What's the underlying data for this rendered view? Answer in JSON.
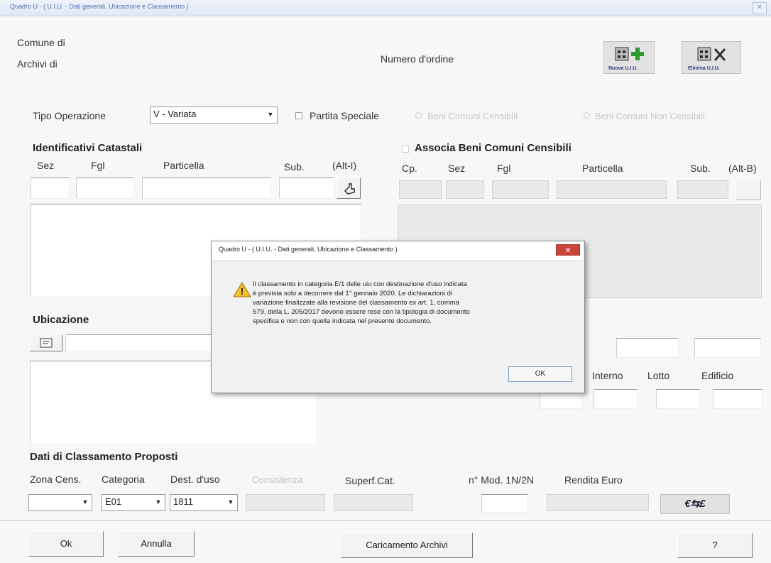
{
  "window": {
    "title": "Quadro U - ( U.I.U. - Dati generali, Ubicazione e Classamento )",
    "close_glyph": "✕"
  },
  "header": {
    "comune_label": "Comune di",
    "archivi_label": "Archivi di",
    "numero_ordine_label": "Numero d'ordine",
    "nuova_uiu_label": "Nuova U.I.U.",
    "elimina_uiu_label": "Elimina U.I.U."
  },
  "tipo_operazione": {
    "label": "Tipo Operazione",
    "value": "V - Variata",
    "partita_speciale_label": "Partita Speciale",
    "beni_censibili_label": "Beni Comuni Censibili",
    "beni_non_censibili_label": "Beni Comuni Non Censibili"
  },
  "identificativi": {
    "title": "Identificativi Catastali",
    "col_sez": "Sez",
    "col_fgl": "Fgl",
    "col_particella": "Particella",
    "col_sub": "Sub.",
    "shortcut": "(Alt-I)"
  },
  "associa": {
    "title": "Associa Beni Comuni Censibili",
    "col_cp": "Cp.",
    "col_sez": "Sez",
    "col_fgl": "Fgl",
    "col_particella": "Particella",
    "col_sub": "Sub.",
    "shortcut": "(Alt-B)"
  },
  "ubicazione": {
    "title": "Ubicazione",
    "interno_label": "Interno",
    "lotto_label": "Lotto",
    "edificio_label": "Edificio"
  },
  "classamento": {
    "title": "Dati di Classamento Proposti",
    "zona_label": "Zona Cens.",
    "categoria_label": "Categoria",
    "dest_label": "Dest. d'uso",
    "consistenza_label": "Consistenza",
    "superf_label": "Superf.Cat.",
    "nmod_label": "n° Mod. 1N/2N",
    "rendita_label": "Rendita Euro",
    "categoria_value": "E01",
    "dest_value": "1811",
    "currency_label": "€⇆£"
  },
  "footer": {
    "ok_label": "Ok",
    "annulla_label": "Annulla",
    "caricamento_label": "Caricamento Archivi",
    "help_label": "?"
  },
  "dialog": {
    "title": "Quadro U - ( U.I.U. - Dati generali, Ubicazione e Classamento )",
    "message_line1": "Il classamento in categoria E/1 delle uiu con destinazione d'uso indicata",
    "message_line2": "è prevista solo a decorrere dal 1° gennaio 2020. Le dichiarazioni di",
    "message_line3": "variazione finalizzate alla revisione del classamento ex art. 1, comma",
    "message_line4": "579, della L. 205/2017 devono essere rese con la tipologia di documento",
    "message_line5": "specifica e non con quella indicata nel presente documento.",
    "ok_label": "OK",
    "close_glyph": "✕",
    "warning_glyph": "!"
  }
}
